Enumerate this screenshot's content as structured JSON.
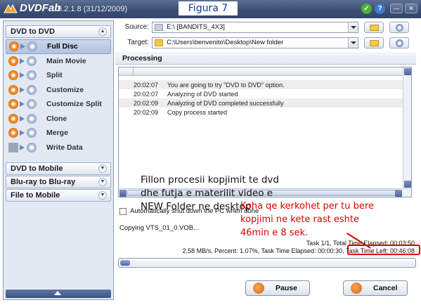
{
  "titlebar": {
    "app_name": "DVDFab",
    "version": "6.2.1.8 (31/12/2009)",
    "figure_label": "Figura 7",
    "icons": [
      "check-icon",
      "help-icon",
      "minimize-icon",
      "close-icon"
    ],
    "accent": "#3c4f72"
  },
  "sidebar": {
    "section_main": "DVD to DVD",
    "items": [
      {
        "label": "Full Disc",
        "selected": true
      },
      {
        "label": "Main Movie",
        "selected": false
      },
      {
        "label": "Split",
        "selected": false
      },
      {
        "label": "Customize",
        "selected": false
      },
      {
        "label": "Customize Split",
        "selected": false
      },
      {
        "label": "Clone",
        "selected": false
      },
      {
        "label": "Merge",
        "selected": false
      },
      {
        "label": "Write Data",
        "selected": false
      }
    ],
    "collapsed_sections": [
      "DVD to Mobile",
      "Blu-ray to Blu-ray",
      "File to Mobile"
    ]
  },
  "main": {
    "source_label": "Source:",
    "source_value": "E:\\ [BANDITS_4X3]",
    "target_label": "Target:",
    "target_value": "C:\\Users\\benvenito\\Desktop\\New folder",
    "processing_title": "Processing",
    "log": [
      {
        "time": "20:02:07",
        "message": "You are going to try \"DVD to DVD\" option."
      },
      {
        "time": "20:02:07",
        "message": "Analyzing of DVD started"
      },
      {
        "time": "20:02:09",
        "message": "Analyzing of DVD completed successfully"
      },
      {
        "time": "20:02:09",
        "message": "Copy process started"
      }
    ],
    "overlay_note": "Fillon procesii kopjimit te dvd dhe futja e materilit video e NEW Folder ne desktop.",
    "auto_shutdown_label": "Automatically shut down the PC when done",
    "copying_text": "Copying VTS_01_0.VOB...",
    "task_line1": "Task 1/1,  Total Time Elapsed: 00:03:50",
    "task_line2": "2.58 MB/s,  Percent: 1.07%,  Task Time Elapsed: 00:00:30,  Task Time Left: 00:46:08",
    "red_note": "Koha qe kerkohet per tu bere kopjimi ne kete rast eshte 46min e 8 sek.",
    "progress_fraction": 0.0107,
    "pause_label": "Pause",
    "cancel_label": "Cancel"
  }
}
